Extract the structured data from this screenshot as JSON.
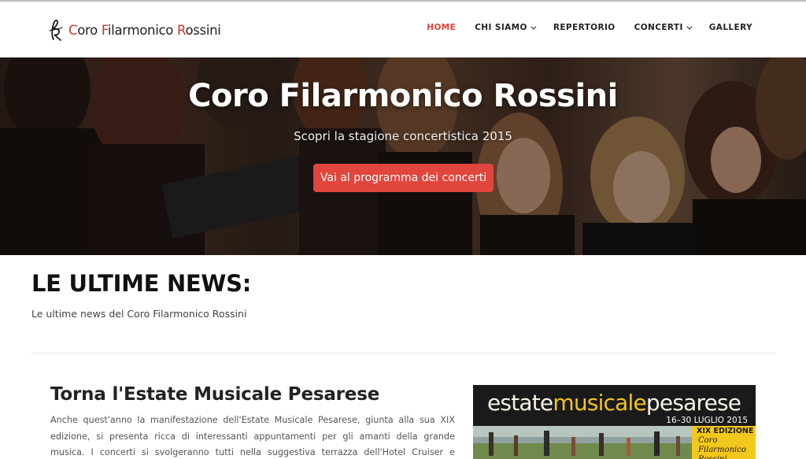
{
  "navbar": {
    "logo": {
      "initial": "ℛ",
      "text_parts": [
        "C",
        "oro ",
        "F",
        "ilarmonico ",
        "R",
        "ossini"
      ]
    },
    "items": [
      {
        "label": "HOME",
        "active": true,
        "dropdown": false
      },
      {
        "label": "CHI SIAMO",
        "active": false,
        "dropdown": true
      },
      {
        "label": "REPERTORIO",
        "active": false,
        "dropdown": false
      },
      {
        "label": "CONCERTI",
        "active": false,
        "dropdown": true
      },
      {
        "label": "GALLERY",
        "active": false,
        "dropdown": false
      }
    ]
  },
  "hero": {
    "title": "Coro Filarmonico Rossini",
    "subtitle": "Scopri la stagione concertistica 2015",
    "button_label": "Vai al programma dei concerti"
  },
  "news": {
    "heading": "LE ULTIME NEWS:",
    "subheading": "Le ultime news del Coro Filarmonico Rossini"
  },
  "article": {
    "title": "Torna l'Estate Musicale Pesarese",
    "body": "Anche quest'anno la manifestazione dell'Estate Musicale Pesarese, giunta alla sua XIX edizione, si presenta ricca di interessanti appuntamenti per gli amanti della grande musica. I concerti si svolgeranno tutti nella suggestiva terrazza dell'Hotel Cruiser e vedranno l'alternarsi di grandi opere"
  },
  "poster": {
    "word_estate": "estate",
    "word_musicale": "musicale",
    "word_pesarese": "pesarese",
    "dates": "16–30 LUGLIO 2015",
    "edition": "XIX EDIZIONE",
    "name": "Coro Filarmonico Rossini"
  },
  "colors": {
    "accent": "#e0463d",
    "text_dark": "#222222",
    "poster_yellow": "#f5c518"
  }
}
